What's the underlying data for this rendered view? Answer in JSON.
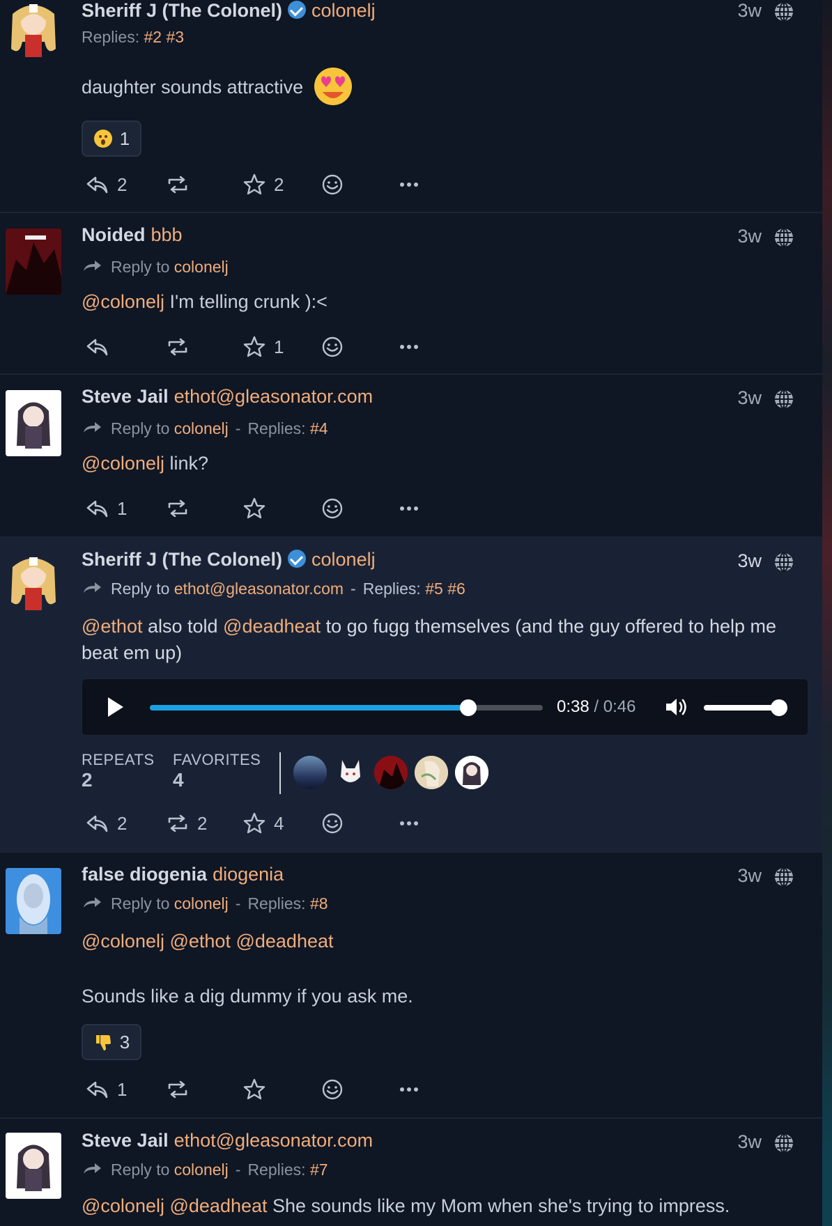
{
  "posts": [
    {
      "name": "Sheriff J (The Colonel)",
      "handle": "colonelj",
      "time": "3w",
      "replies_label": "Replies:",
      "replies": [
        "#2",
        "#3"
      ],
      "text": "daughter sounds attractive",
      "reaction": {
        "count": "1"
      },
      "actions": {
        "replies": "2",
        "repeats": "",
        "favorites": "2"
      }
    },
    {
      "name": "Noided",
      "handle": "bbb",
      "time": "3w",
      "reply_to_label": "Reply to",
      "reply_to": "colonelj",
      "mention": "@colonelj",
      "text": " I'm telling crunk ):<",
      "actions": {
        "replies": "",
        "repeats": "",
        "favorites": "1"
      }
    },
    {
      "name": "Steve Jail",
      "handle": "ethot@gleasonator.com",
      "time": "3w",
      "reply_to_label": "Reply to",
      "reply_to": "colonelj",
      "replies_label": "Replies:",
      "replies": [
        "#4"
      ],
      "mention": "@colonelj",
      "text": " link?",
      "actions": {
        "replies": "1",
        "repeats": "",
        "favorites": ""
      }
    },
    {
      "name": "Sheriff J (The Colonel)",
      "handle": "colonelj",
      "time": "3w",
      "reply_to_label": "Reply to",
      "reply_to": "ethot@gleasonator.com",
      "replies_label": "Replies:",
      "replies": [
        "#5",
        "#6"
      ],
      "mention1": "@ethot",
      "text1": " also told ",
      "mention2": "@deadheat",
      "text2": " to go fugg themselves (and the guy offered to help me beat em up)",
      "audio": {
        "current": "0:38",
        "total": "0:46",
        "progress": 0.81,
        "volume": 1.0
      },
      "stats": {
        "repeats_label": "REPEATS",
        "repeats": "2",
        "favorites_label": "FAVORITES",
        "favorites": "4"
      },
      "actions": {
        "replies": "2",
        "repeats": "2",
        "favorites": "4"
      }
    },
    {
      "name": "false diogenia",
      "handle": "diogenia",
      "time": "3w",
      "reply_to_label": "Reply to",
      "reply_to": "colonelj",
      "replies_label": "Replies:",
      "replies": [
        "#8"
      ],
      "mentions": [
        "@colonelj",
        "@ethot",
        "@deadheat"
      ],
      "text": "Sounds like a dig dummy if you ask me.",
      "reaction": {
        "count": "3"
      },
      "actions": {
        "replies": "1",
        "repeats": "",
        "favorites": ""
      }
    },
    {
      "name": "Steve Jail",
      "handle": "ethot@gleasonator.com",
      "time": "3w",
      "reply_to_label": "Reply to",
      "reply_to": "colonelj",
      "replies_label": "Replies:",
      "replies": [
        "#7"
      ],
      "mentions": [
        "@colonelj",
        "@deadheat"
      ],
      "text": " She sounds like my Mom when she's trying to impress."
    }
  ],
  "colors": {
    "accent": "#f0ad7b",
    "background": "#0f1624",
    "highlight": "#192235",
    "audio_progress": "#1ba1e2"
  },
  "icons": [
    "reply-icon",
    "repeat-icon",
    "star-icon",
    "emoji-icon",
    "more-icon",
    "globe-icon",
    "verified-icon",
    "play-icon",
    "volume-icon"
  ]
}
